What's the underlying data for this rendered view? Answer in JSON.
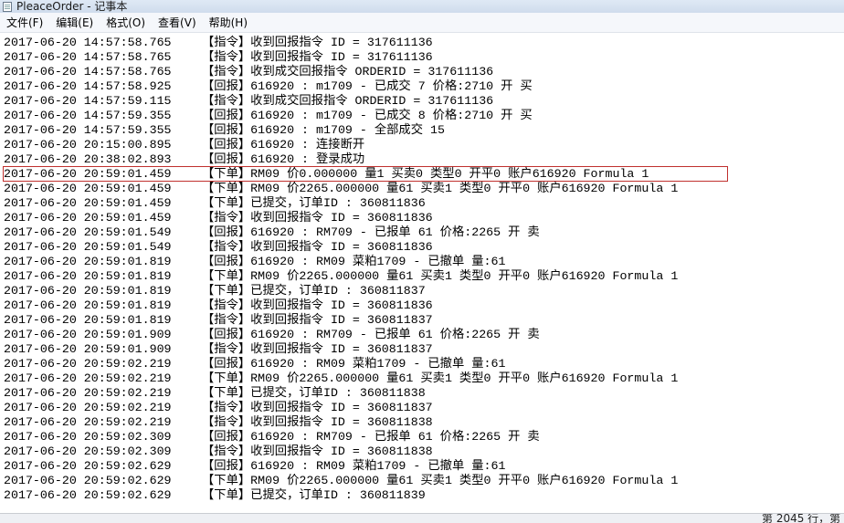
{
  "window": {
    "title": "PleaceOrder - 记事本"
  },
  "menu": [
    "文件(F)",
    "编辑(E)",
    "格式(O)",
    "查看(V)",
    "帮助(H)"
  ],
  "lines": [
    {
      "time": "2017-06-20 14:57:58.765",
      "text": "【指令】收到回报指令 ID = 317611136"
    },
    {
      "time": "2017-06-20 14:57:58.765",
      "text": "【指令】收到回报指令 ID = 317611136"
    },
    {
      "time": "2017-06-20 14:57:58.765",
      "text": "【指令】收到成交回报指令 ORDERID = 317611136"
    },
    {
      "time": "2017-06-20 14:57:58.925",
      "text": "【回报】616920 : m1709 - 已成交 7 价格:2710 开 买"
    },
    {
      "time": "2017-06-20 14:57:59.115",
      "text": "【指令】收到成交回报指令 ORDERID = 317611136"
    },
    {
      "time": "2017-06-20 14:57:59.355",
      "text": "【回报】616920 : m1709 - 已成交 8 价格:2710 开 买"
    },
    {
      "time": "2017-06-20 14:57:59.355",
      "text": "【回报】616920 : m1709 - 全部成交 15"
    },
    {
      "time": "2017-06-20 20:15:00.895",
      "text": "【回报】616920 : 连接断开"
    },
    {
      "time": "2017-06-20 20:38:02.893",
      "text": "【回报】616920 : 登录成功"
    },
    {
      "time": "2017-06-20 20:59:01.459",
      "text": "【下单】RM09 价0.000000 量1 买卖0 类型0 开平0 账户616920 Formula 1"
    },
    {
      "time": "2017-06-20 20:59:01.459",
      "text": "【下单】RM09 价2265.000000 量61 买卖1 类型0 开平0 账户616920 Formula 1"
    },
    {
      "time": "2017-06-20 20:59:01.459",
      "text": "【下单】已提交，订单ID : 360811836"
    },
    {
      "time": "2017-06-20 20:59:01.459",
      "text": "【指令】收到回报指令 ID = 360811836"
    },
    {
      "time": "2017-06-20 20:59:01.549",
      "text": "【回报】616920 : RM709 - 已报单 61 价格:2265 开 卖"
    },
    {
      "time": "2017-06-20 20:59:01.549",
      "text": "【指令】收到回报指令 ID = 360811836"
    },
    {
      "time": "2017-06-20 20:59:01.819",
      "text": "【回报】616920 : RM09 菜粕1709 - 已撤单 量:61"
    },
    {
      "time": "2017-06-20 20:59:01.819",
      "text": "【下单】RM09 价2265.000000 量61 买卖1 类型0 开平0 账户616920 Formula 1"
    },
    {
      "time": "2017-06-20 20:59:01.819",
      "text": "【下单】已提交，订单ID : 360811837"
    },
    {
      "time": "2017-06-20 20:59:01.819",
      "text": "【指令】收到回报指令 ID = 360811836"
    },
    {
      "time": "2017-06-20 20:59:01.819",
      "text": "【指令】收到回报指令 ID = 360811837"
    },
    {
      "time": "2017-06-20 20:59:01.909",
      "text": "【回报】616920 : RM709 - 已报单 61 价格:2265 开 卖"
    },
    {
      "time": "2017-06-20 20:59:01.909",
      "text": "【指令】收到回报指令 ID = 360811837"
    },
    {
      "time": "2017-06-20 20:59:02.219",
      "text": "【回报】616920 : RM09 菜粕1709 - 已撤单 量:61"
    },
    {
      "time": "2017-06-20 20:59:02.219",
      "text": "【下单】RM09 价2265.000000 量61 买卖1 类型0 开平0 账户616920 Formula 1"
    },
    {
      "time": "2017-06-20 20:59:02.219",
      "text": "【下单】已提交，订单ID : 360811838"
    },
    {
      "time": "2017-06-20 20:59:02.219",
      "text": "【指令】收到回报指令 ID = 360811837"
    },
    {
      "time": "2017-06-20 20:59:02.219",
      "text": "【指令】收到回报指令 ID = 360811838"
    },
    {
      "time": "2017-06-20 20:59:02.309",
      "text": "【回报】616920 : RM709 - 已报单 61 价格:2265 开 卖"
    },
    {
      "time": "2017-06-20 20:59:02.309",
      "text": "【指令】收到回报指令 ID = 360811838"
    },
    {
      "time": "2017-06-20 20:59:02.629",
      "text": "【回报】616920 : RM09 菜粕1709 - 已撤单 量:61"
    },
    {
      "time": "2017-06-20 20:59:02.629",
      "text": "【下单】RM09 价2265.000000 量61 买卖1 类型0 开平0 账户616920 Formula 1"
    },
    {
      "time": "2017-06-20 20:59:02.629",
      "text": "【下单】已提交，订单ID : 360811839"
    }
  ],
  "highlighted_line_index": 9,
  "highlight_color": "#c0302e",
  "status": {
    "position": "第 2045 行，第"
  }
}
